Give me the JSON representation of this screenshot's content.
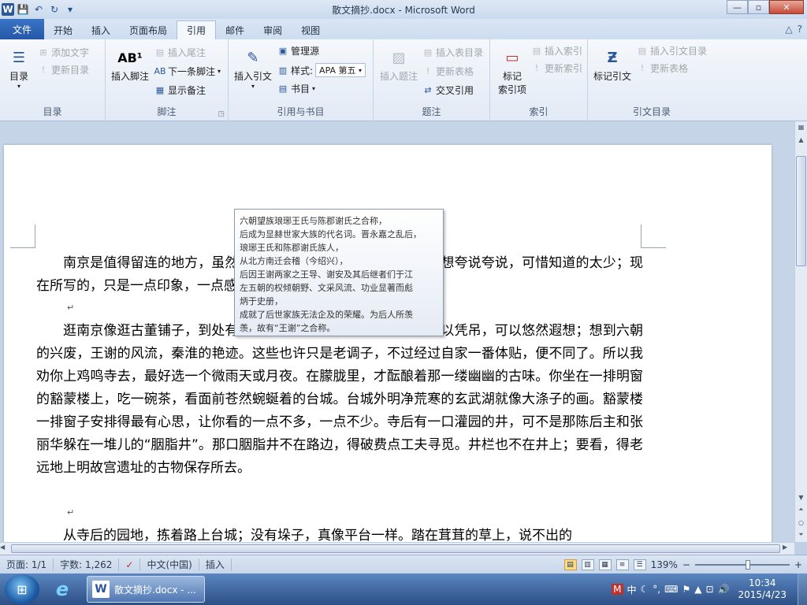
{
  "window": {
    "title": "散文摘抄.docx - Microsoft Word",
    "logo": "W",
    "controls": {
      "minimize": "—",
      "maximize": "▫",
      "close": "✕"
    }
  },
  "qat": {
    "save": "💾",
    "undo": "↶",
    "redo": "↻",
    "more": "▾"
  },
  "tabs": [
    {
      "label": "文件"
    },
    {
      "label": "开始"
    },
    {
      "label": "插入"
    },
    {
      "label": "页面布局"
    },
    {
      "label": "引用"
    },
    {
      "label": "邮件"
    },
    {
      "label": "审阅"
    },
    {
      "label": "视图"
    }
  ],
  "tab_right": {
    "minimize_ribbon": "△",
    "help": "?"
  },
  "ribbon": {
    "toc": {
      "label": "目录",
      "big": "目录",
      "add_text": "添加文字",
      "update": "更新目录"
    },
    "footnotes": {
      "label": "脚注",
      "big": "插入脚注",
      "big_icon": "AB¹",
      "endnote": "插入尾注",
      "next": "下一条脚注",
      "show": "显示备注"
    },
    "citations": {
      "label": "引用与书目",
      "big": "插入引文",
      "manage": "管理源",
      "style_label": "样式:",
      "style_value": "APA 第五",
      "bibliography": "书目"
    },
    "captions": {
      "label": "题注",
      "big": "插入题注",
      "insert_table": "插入表目录",
      "update_table": "更新表格",
      "cross_ref": "交叉引用"
    },
    "index": {
      "label": "索引",
      "big_line1": "标记",
      "big_line2": "索引项",
      "insert": "插入索引",
      "update": "更新索引"
    },
    "toa": {
      "label": "引文目录",
      "big": "标记引文",
      "insert": "插入引文目录",
      "update": "更新表格"
    }
  },
  "document": {
    "para1": "南京是值得留连的地方，虽然我只去过两回；一回是在夏天。也想夸说夸说，可惜知道的太少；现在所写的，只是一点印象，一点感觉罢了。",
    "para2": "逛南京像逛古董铺子，到处有时代侵蚀的痕迹。你可以摩挲，可以凭吊，可以悠然遐想；想到六朝的兴废，王谢的风流，秦淮的艳迹。这些也许只是老调子，不过经过自家一番体贴，便不同了。所以我劝你上鸡鸣寺去，最好选一个微雨天或月夜。在朦胧里，才酝酿着那一缕幽幽的古味。你坐在一排明窗的豁蒙楼上，吃一碗茶，看面前苍然蜿蜒着的台城。台城外明净荒寒的玄武湖就像大涤子的画。豁蒙楼一排窗子安排得最有心思，让你看的一点不多，一点不少。寺后有一口灌园的井，可不是那陈后主和张丽华躲在一堆儿的“胭脂井”。那口胭脂井不在路边，得破费点工夫寻觅。井栏也不在井上；要看，得老远地上明故宫遗址的古物保存所去。",
    "para3": "从寺后的园地，拣着路上台城；没有垛子，真像平台一样。踏在茸茸的草上，说不出的",
    "para_mark": "↵"
  },
  "tooltip": {
    "lines": [
      "六朝望族琅琊王氏与陈郡谢氏之合称，",
      "后成为显赫世家大族的代名词。晋永嘉之乱后，",
      "琅琊王氏和陈郡谢氏族人，",
      "从北方南迁会稽（今绍兴），",
      "后因王谢两家之王导、谢安及其后继者们于江",
      "左五朝的权倾朝野、文采风流、功业显著而彪",
      "炳于史册，",
      "成就了后世家族无法企及的荣耀。为后人所羡",
      "羡，故有“王谢”之合称。"
    ]
  },
  "statusbar": {
    "page": "页面: 1/1",
    "words": "字数: 1,262",
    "language": "中文(中国)",
    "mode": "插入",
    "zoom": "139%",
    "zoom_minus": "−",
    "zoom_plus": "+"
  },
  "taskbar": {
    "start": "⊞",
    "ie": "e",
    "word_task": "散文摘抄.docx - ...",
    "tray_ime": "M",
    "tray_lang": "中",
    "tray_moon": "☾",
    "tray_dot": "°,",
    "tray_kbd": "⌨",
    "tray_flag": "⚑",
    "tray_up": "▲",
    "tray_net": "⊡",
    "tray_vol": "🔊",
    "time": "10:34",
    "date": "2015/4/23"
  },
  "colors": {
    "accent": "#2b5797",
    "ribbon_bg": "#e2eaf5",
    "doc_bg": "#c6d4e7"
  }
}
